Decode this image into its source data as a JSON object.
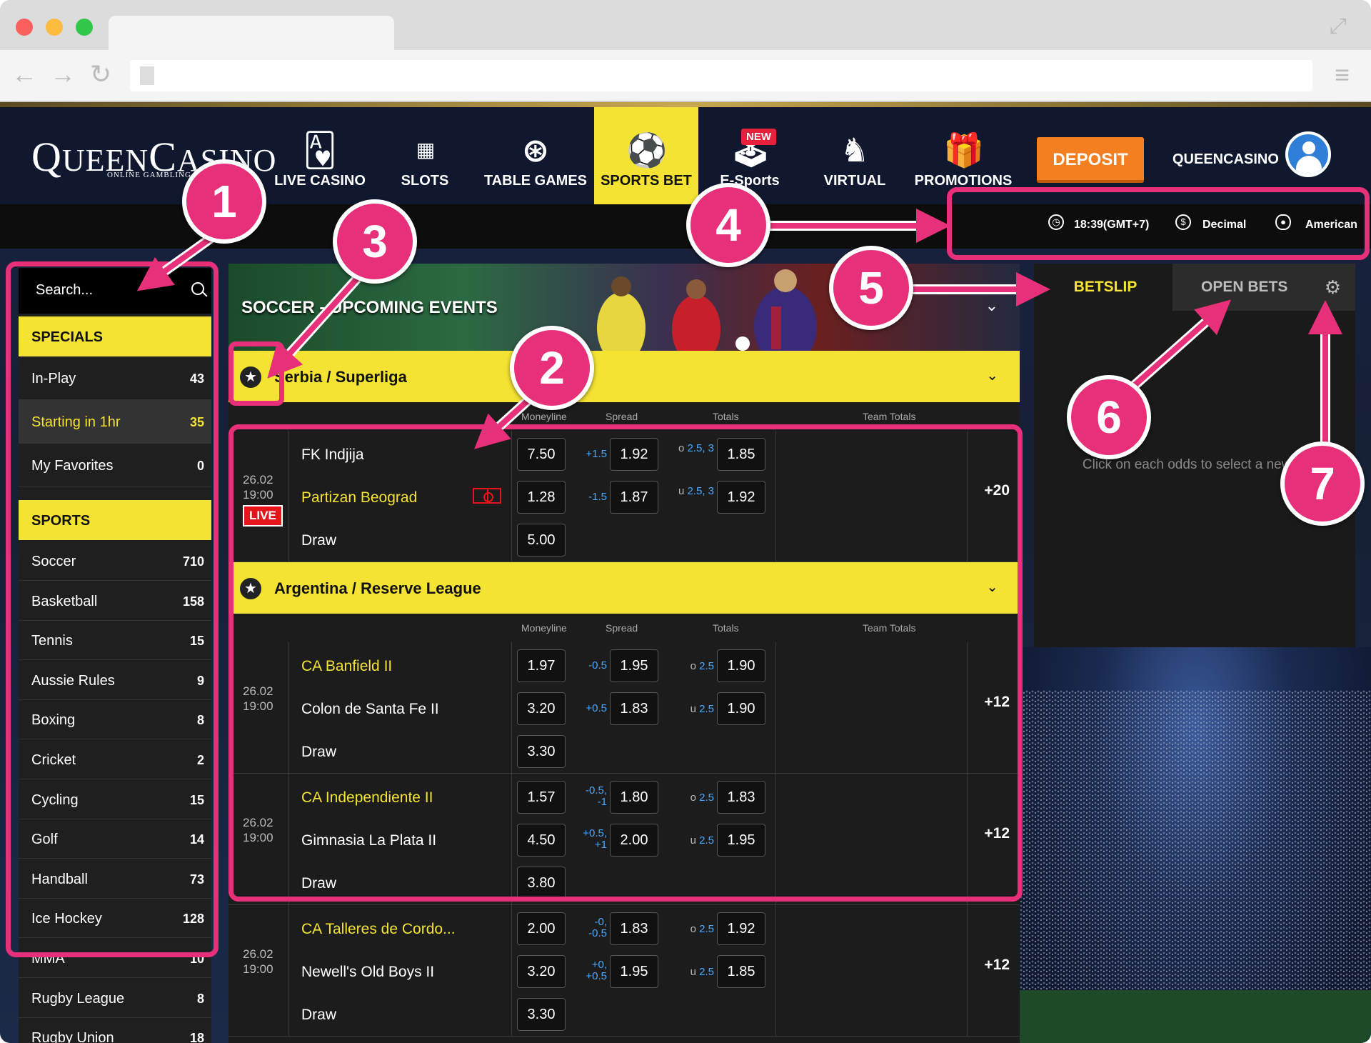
{
  "browser": {
    "back_icon": "arrow-left-icon",
    "forward_icon": "arrow-right-icon",
    "reload_icon": "reload-icon",
    "menu_icon": "hamburger-icon",
    "expand_icon": "expand-icon"
  },
  "logo": {
    "main": "QUEENCASINO",
    "sub": "ONLINE GAMBLING"
  },
  "nav": [
    {
      "label": "LIVE CASINO",
      "icon": "playing-card-icon"
    },
    {
      "label": "SLOTS",
      "icon": "slot-machine-icon"
    },
    {
      "label": "TABLE GAMES",
      "icon": "roulette-icon"
    },
    {
      "label": "SPORTS BET",
      "icon": "sports-balls-icon",
      "active": true
    },
    {
      "label": "E-Sports",
      "icon": "joystick-icon",
      "badge": "NEW"
    },
    {
      "label": "VIRTUAL",
      "icon": "horse-icon"
    },
    {
      "label": "PROMOTIONS",
      "icon": "gift-icon"
    }
  ],
  "deposit_label": "DEPOSIT",
  "username": "QUEENCASINO",
  "subbar": {
    "time": "18:39(GMT+7)",
    "odds_format": "Decimal",
    "view": "American"
  },
  "sidebar": {
    "search_placeholder": "Search...",
    "specials_title": "SPECIALS",
    "specials": [
      {
        "name": "In-Play",
        "count": "43"
      },
      {
        "name": "Starting in 1hr",
        "count": "35",
        "highlight": true
      },
      {
        "name": "My Favorites",
        "count": "0"
      }
    ],
    "sports_title": "SPORTS",
    "sports": [
      {
        "name": "Soccer",
        "count": "710"
      },
      {
        "name": "Basketball",
        "count": "158"
      },
      {
        "name": "Tennis",
        "count": "15"
      },
      {
        "name": "Aussie Rules",
        "count": "9"
      },
      {
        "name": "Boxing",
        "count": "8"
      },
      {
        "name": "Cricket",
        "count": "2"
      },
      {
        "name": "Cycling",
        "count": "15"
      },
      {
        "name": "Golf",
        "count": "14"
      },
      {
        "name": "Handball",
        "count": "73"
      },
      {
        "name": "Ice Hockey",
        "count": "128"
      },
      {
        "name": "MMA",
        "count": "10"
      },
      {
        "name": "Rugby League",
        "count": "8"
      },
      {
        "name": "Rugby Union",
        "count": "18"
      }
    ]
  },
  "main": {
    "hero_title": "SOCCER - UPCOMING EVENTS",
    "columns": {
      "moneyline": "Moneyline",
      "spread": "Spread",
      "totals": "Totals",
      "team_totals": "Team Totals"
    },
    "leagues": [
      {
        "name": "Serbia / Superliga",
        "matches": [
          {
            "date": "26.02",
            "time": "19:00",
            "live": "LIVE",
            "more": "+20",
            "rows": [
              {
                "team": "FK Indjija",
                "ml": "7.50",
                "hcp": "+1.5",
                "spread": "1.92",
                "ou": "o",
                "total": "2.5, 3",
                "tot_odds": "1.85"
              },
              {
                "team": "Partizan Beograd",
                "ml": "1.28",
                "hcp": "-1.5",
                "spread": "1.87",
                "ou": "u",
                "total": "2.5, 3",
                "tot_odds": "1.92"
              },
              {
                "team": "Draw",
                "ml": "5.00"
              }
            ]
          }
        ]
      },
      {
        "name": "Argentina / Reserve League",
        "matches": [
          {
            "date": "26.02",
            "time": "19:00",
            "more": "+12",
            "rows": [
              {
                "team": "CA Banfield II",
                "ml": "1.97",
                "hcp": "-0.5",
                "spread": "1.95",
                "ou": "o",
                "total": "2.5",
                "tot_odds": "1.90"
              },
              {
                "team": "Colon de Santa Fe II",
                "ml": "3.20",
                "hcp": "+0.5",
                "spread": "1.83",
                "ou": "u",
                "total": "2.5",
                "tot_odds": "1.90"
              },
              {
                "team": "Draw",
                "ml": "3.30"
              }
            ]
          },
          {
            "date": "26.02",
            "time": "19:00",
            "more": "+12",
            "rows": [
              {
                "team": "CA Independiente II",
                "ml": "1.57",
                "hcp": "-0.5, -1",
                "spread": "1.80",
                "ou": "o",
                "total": "2.5",
                "tot_odds": "1.83"
              },
              {
                "team": "Gimnasia La Plata II",
                "ml": "4.50",
                "hcp": "+0.5, +1",
                "spread": "2.00",
                "ou": "u",
                "total": "2.5",
                "tot_odds": "1.95"
              },
              {
                "team": "Draw",
                "ml": "3.80"
              }
            ]
          },
          {
            "date": "26.02",
            "time": "19:00",
            "more": "+12",
            "rows": [
              {
                "team": "CA Talleres de Cordo...",
                "ml": "2.00",
                "hcp": "-0, -0.5",
                "spread": "1.83",
                "ou": "o",
                "total": "2.5",
                "tot_odds": "1.92"
              },
              {
                "team": "Newell's Old Boys II",
                "ml": "3.20",
                "hcp": "+0, +0.5",
                "spread": "1.95",
                "ou": "u",
                "total": "2.5",
                "tot_odds": "1.85"
              },
              {
                "team": "Draw",
                "ml": "3.30"
              }
            ]
          }
        ]
      }
    ]
  },
  "betslip": {
    "tab_betslip": "BETSLIP",
    "tab_open_bets": "OPEN BETS",
    "empty_msg": "Click on each odds to select a new bet"
  },
  "annotations": [
    "1",
    "2",
    "3",
    "4",
    "5",
    "6",
    "7"
  ],
  "colors": {
    "accent_yellow": "#f4e332",
    "deposit_orange": "#f47f20",
    "annotation_pink": "#e8307a",
    "live_red": "#e8141c",
    "link_blue": "#4aa8ff"
  }
}
